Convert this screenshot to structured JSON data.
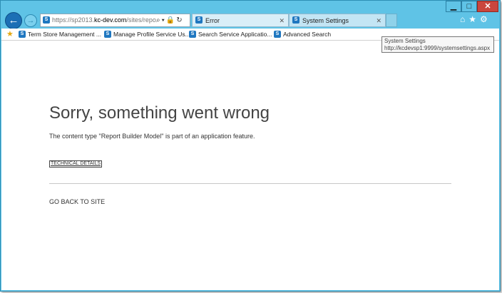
{
  "window": {
    "caption_buttons": {
      "minimize": "▁",
      "maximize": "□",
      "close": "✕"
    }
  },
  "nav": {
    "back_icon": "←",
    "forward_icon": "→"
  },
  "address_bar": {
    "url_prefix": "https://sp2013.",
    "url_domain": "kc-dev.com",
    "url_path": "/sites/reportir",
    "icons": "⌕▾🔒↻"
  },
  "tabs": [
    {
      "label": "Error",
      "close": "✕"
    },
    {
      "label": "System Settings",
      "close": "✕"
    }
  ],
  "toolbar_icons": {
    "home": "⌂",
    "favorites": "★",
    "settings": "⚙"
  },
  "favorites": [
    {
      "label": "Term Store Management ..."
    },
    {
      "label": "Manage Profile Service Us..."
    },
    {
      "label": "Search Service Applicatio..."
    },
    {
      "label": "Advanced Search"
    }
  ],
  "tooltip": {
    "title": "System Settings",
    "url": "http://kcdevsp1:9999/systemsettings.aspx"
  },
  "page": {
    "heading": "Sorry, something went wrong",
    "message": "The content type \"Report Builder Model\" is part of an application feature.",
    "technical_details": "TECHNICAL DETAILS",
    "go_back": "GO BACK TO SITE"
  },
  "colors": {
    "frame": "#5fc3e6",
    "close_button": "#c9463d",
    "sharepoint_icon": "#1f77c0"
  }
}
